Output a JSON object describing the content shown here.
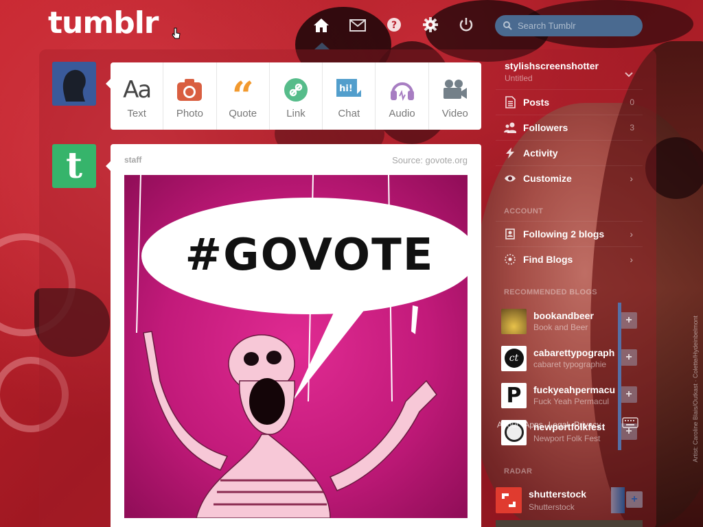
{
  "header": {
    "logo": "tumblr",
    "search_placeholder": "Search Tumblr",
    "nav": [
      "home-icon",
      "mail-icon",
      "help-icon",
      "gear-icon",
      "power-icon"
    ]
  },
  "post_types": [
    {
      "label": "Text",
      "icon": "text-icon",
      "color": "#444444"
    },
    {
      "label": "Photo",
      "icon": "camera-icon",
      "color": "#d95e40"
    },
    {
      "label": "Quote",
      "icon": "quote-icon",
      "color": "#f2992e"
    },
    {
      "label": "Link",
      "icon": "link-icon",
      "color": "#56bc8a"
    },
    {
      "label": "Chat",
      "icon": "chat-icon",
      "color": "#529ecc"
    },
    {
      "label": "Audio",
      "icon": "headphones-icon",
      "color": "#a77dc2"
    },
    {
      "label": "Video",
      "icon": "video-camera-icon",
      "color": "#748089"
    }
  ],
  "post": {
    "author": "staff",
    "source": "Source: govote.org",
    "image_text": "#GOVOTE"
  },
  "sidebar": {
    "blog_name": "stylishscreenshotter",
    "blog_subtitle": "Untitled",
    "items": [
      {
        "label": "Posts",
        "count": "0"
      },
      {
        "label": "Followers",
        "count": "3"
      },
      {
        "label": "Activity",
        "count": ""
      },
      {
        "label": "Customize",
        "count": ""
      }
    ],
    "account_heading": "ACCOUNT",
    "account_items": [
      {
        "label": "Following 2 blogs"
      },
      {
        "label": "Find Blogs"
      }
    ],
    "recommended_heading": "RECOMMENDED BLOGS",
    "recommended": [
      {
        "name": "bookandbeer",
        "subtitle": "Book and Beer"
      },
      {
        "name": "cabarettypograph",
        "subtitle": "cabaret typographie"
      },
      {
        "name": "fuckyeahpermacu",
        "subtitle": "Fuck Yeah Permacul"
      },
      {
        "name": "newportfolkfest",
        "subtitle": "Newport Folk Fest"
      }
    ],
    "footer_links": [
      "About",
      "Apps",
      "Legal",
      "Privacy"
    ],
    "radar_heading": "RADAR",
    "radar": {
      "name": "shutterstock",
      "subtitle": "Shutterstock"
    }
  },
  "background_credit": "Artist: Caroline Blais/Outkast · Colette/Hydeinbelmont",
  "colors": {
    "accent_search": "#4a6a90",
    "staff_avatar": "#36b46b",
    "recommended_bar": "#5570a6"
  }
}
